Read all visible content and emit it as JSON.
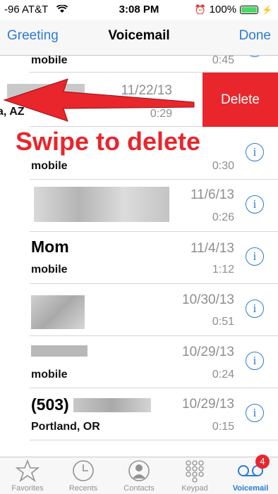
{
  "status": {
    "carrier": "-96 AT&T",
    "time": "3:08 PM",
    "battery": "100%"
  },
  "nav": {
    "left": "Greeting",
    "title": "Voicemail",
    "right": "Done"
  },
  "rows": [
    {
      "name": "",
      "sub": "mobile",
      "date": "",
      "dur": "0:45"
    },
    {
      "name": "",
      "sub": "a, AZ",
      "date": "11/22/13",
      "dur": "0:29"
    },
    {
      "name": "",
      "sub": "mobile",
      "date": "",
      "dur": "0:30"
    },
    {
      "name": "",
      "sub": "",
      "date": "11/6/13",
      "dur": "0:26"
    },
    {
      "name": "Mom",
      "sub": "mobile",
      "date": "11/4/13",
      "dur": "1:12"
    },
    {
      "name": "",
      "sub": "",
      "date": "10/30/13",
      "dur": "0:51"
    },
    {
      "name": "",
      "sub": "mobile",
      "date": "10/29/13",
      "dur": "0:24"
    },
    {
      "name": "(503)",
      "sub": "Portland, OR",
      "date": "10/29/13",
      "dur": "0:15"
    }
  ],
  "delete_label": "Delete",
  "annotation": "Swipe to delete",
  "tabs": [
    {
      "label": "Favorites",
      "icon": "star-icon"
    },
    {
      "label": "Recents",
      "icon": "clock-icon"
    },
    {
      "label": "Contacts",
      "icon": "person-icon"
    },
    {
      "label": "Keypad",
      "icon": "keypad-icon"
    },
    {
      "label": "Voicemail",
      "icon": "voicemail-icon",
      "badge": "4"
    }
  ],
  "colors": {
    "accent": "#2a7bd8",
    "delete": "#e8262c"
  }
}
